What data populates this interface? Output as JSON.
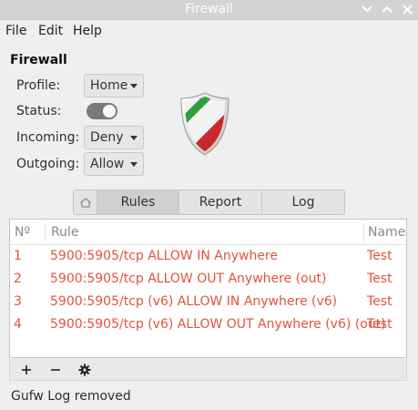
{
  "window": {
    "title": "Firewall"
  },
  "menu": [
    "File",
    "Edit",
    "Help"
  ],
  "section_title": "Firewall",
  "profile": {
    "label": "Profile:",
    "value": "Home"
  },
  "status": {
    "label": "Status:",
    "enabled": true
  },
  "incoming": {
    "label": "Incoming:",
    "value": "Deny"
  },
  "outgoing": {
    "label": "Outgoing:",
    "value": "Allow"
  },
  "tabs": {
    "home_icon": "home-icon",
    "rules": "Rules",
    "report": "Report",
    "log": "Log"
  },
  "table": {
    "columns": {
      "num": "Nº",
      "rule": "Rule",
      "name": "Name"
    },
    "rows": [
      {
        "num": "1",
        "rule": "5900:5905/tcp ALLOW IN Anywhere",
        "name": "Test"
      },
      {
        "num": "2",
        "rule": "5900:5905/tcp ALLOW OUT Anywhere (out)",
        "name": "Test"
      },
      {
        "num": "3",
        "rule": "5900:5905/tcp (v6) ALLOW IN Anywhere (v6)",
        "name": "Test"
      },
      {
        "num": "4",
        "rule": "5900:5905/tcp (v6) ALLOW OUT Anywhere (v6) (out)",
        "name": "Test"
      }
    ]
  },
  "toolbar": {
    "add_icon": "plus-icon",
    "remove_icon": "minus-icon",
    "settings_icon": "gear-icon"
  },
  "statusbar": {
    "text": "Gufw Log removed"
  },
  "colors": {
    "rule_text": "#e2543a",
    "titlebar_bg": "#d3d3d3",
    "toggle_on": "#7a7a7a"
  }
}
